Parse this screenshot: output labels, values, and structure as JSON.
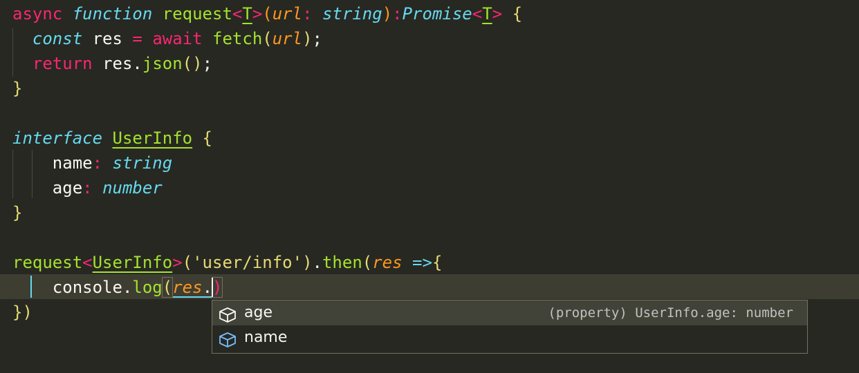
{
  "editor": {
    "theme_colors": {
      "background": "#272822",
      "keyword": "#f92672",
      "storage": "#66d9ef",
      "function": "#a6e22e",
      "parameter": "#fd971f",
      "string": "#e6db74",
      "text": "#f8f8f2"
    },
    "code": {
      "l1": {
        "kw_async": "async",
        "kw_function": "function",
        "fn_name": "request",
        "lt1": "<",
        "type_param": "T",
        "gt1": ">",
        "paren_open": "(",
        "param": "url",
        "colon1": ":",
        "type_string": "string",
        "paren_close": ")",
        "colon2": ":",
        "type_promise": "Promise",
        "lt2": "<",
        "type_param2": "T",
        "gt2": ">",
        "brace": "{"
      },
      "l2": {
        "kw_const": "const",
        "var": "res",
        "eq": "=",
        "kw_await": "await",
        "fn_fetch": "fetch",
        "paren_open": "(",
        "arg": "url",
        "paren_close": ")",
        "semi": ";"
      },
      "l3": {
        "kw_return": "return",
        "obj": "res",
        "dot": ".",
        "fn_json": "json",
        "parens": "()",
        "semi": ";"
      },
      "l4": {
        "brace": "}"
      },
      "l6": {
        "kw_interface": "interface",
        "name": "UserInfo",
        "brace": "{"
      },
      "l7": {
        "prop": "name",
        "colon": ":",
        "type": "string"
      },
      "l8": {
        "prop": "age",
        "colon": ":",
        "type": "number"
      },
      "l9": {
        "brace": "}"
      },
      "l11": {
        "fn_request": "request",
        "lt": "<",
        "type_arg": "UserInfo",
        "gt": ">",
        "paren_open": "(",
        "str": "'user/info'",
        "paren_close": ")",
        "dot": ".",
        "fn_then": "then",
        "paren_open2": "(",
        "param": "res",
        "arrow": "=>",
        "brace": "{"
      },
      "l12": {
        "obj_console": "console",
        "dot": ".",
        "fn_log": "log",
        "paren_open": "(",
        "arg": "res",
        "dot2": ".",
        "paren_close": ")"
      },
      "l13": {
        "brace": "}",
        "paren": ")"
      }
    }
  },
  "suggest": {
    "items": [
      {
        "icon": "property-cube-icon",
        "label": "age",
        "detail": "(property) UserInfo.age: number",
        "selected": true
      },
      {
        "icon": "property-cube-icon",
        "label": "name",
        "detail": "",
        "selected": false
      }
    ]
  }
}
